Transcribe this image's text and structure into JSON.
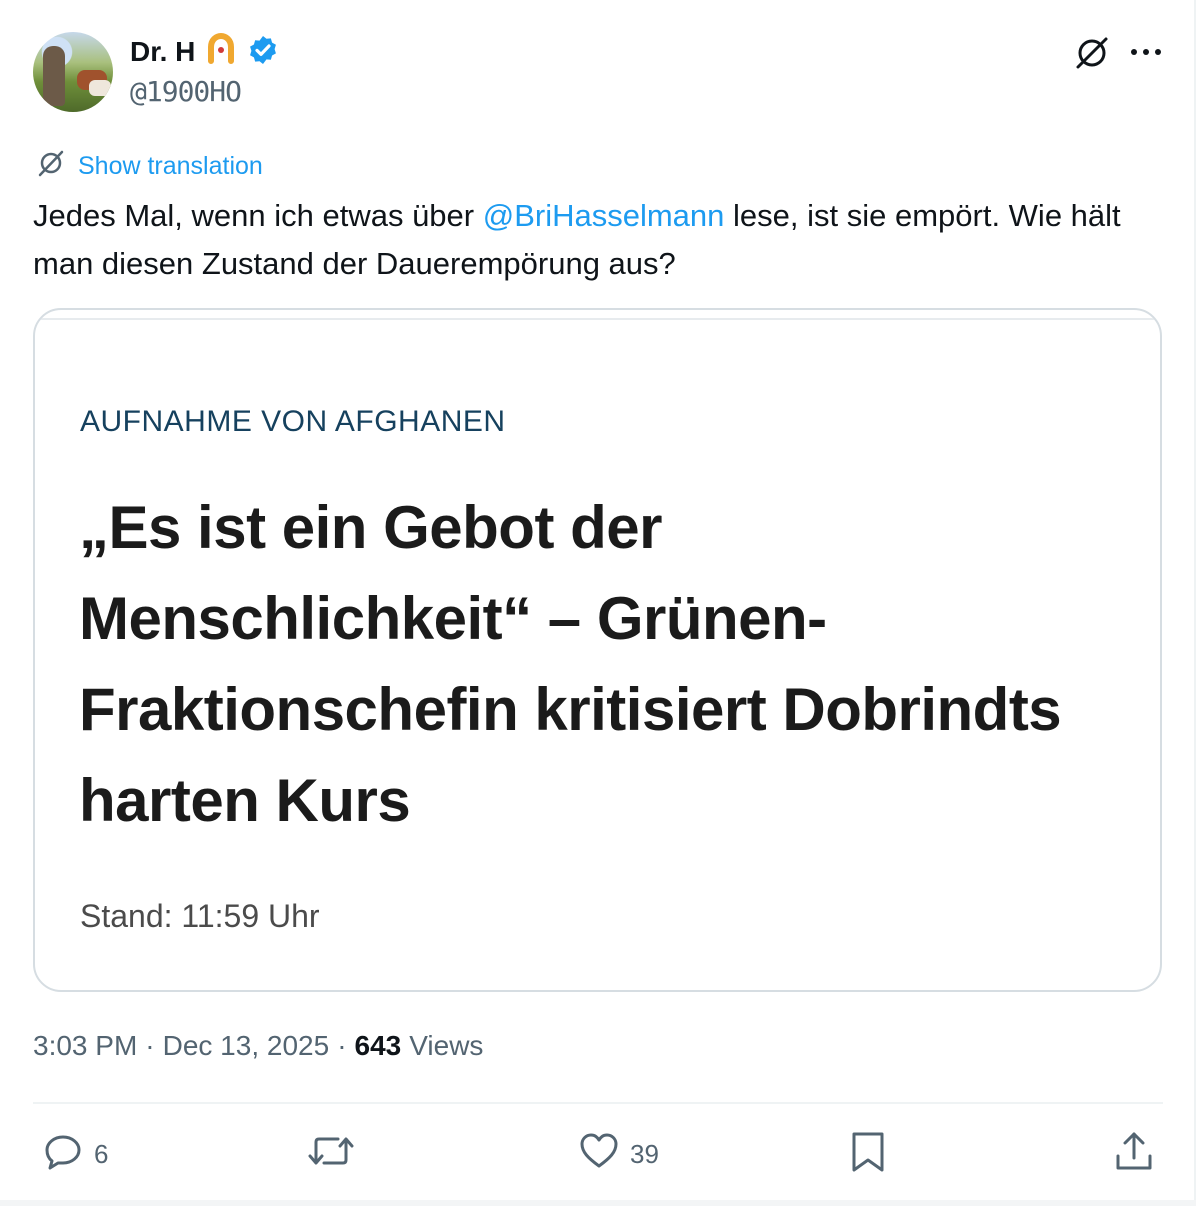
{
  "author": {
    "display_name": "Dr. H",
    "handle": "@1900HO"
  },
  "top_icons": [
    "grok-icon",
    "more-icon"
  ],
  "translation": {
    "label": "Show translation"
  },
  "tweet": {
    "text_before": "Jedes Mal, wenn ich etwas über ",
    "mention": "@BriHasselmann",
    "text_after": " lese, ist sie empört. Wie hält man diesen Zustand der Dauerempörung aus?"
  },
  "card": {
    "kicker": "AUFNAHME VON AFGHANEN",
    "headline": "„Es ist ein Gebot der Menschlichkeit“ – Grünen-Fraktionschefin kritisiert Dobrindts harten Kurs",
    "stand": "Stand: 11:59 Uhr"
  },
  "meta": {
    "time": "3:03 PM",
    "separator1": "·",
    "date": "Dec 13, 2025",
    "separator2": "·",
    "views_count": "643",
    "views_label": "Views"
  },
  "actions": {
    "replies": "6",
    "reposts": "",
    "likes": "39"
  },
  "colors": {
    "accent": "#1d9bf0",
    "text": "#0f1419",
    "muted": "#536471",
    "kicker": "#16415e"
  }
}
